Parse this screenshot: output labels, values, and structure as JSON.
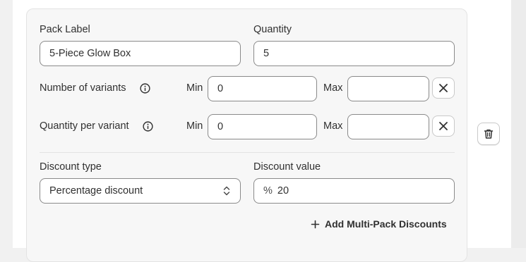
{
  "pack": {
    "pack_label": {
      "label": "Pack Label",
      "value": "5-Piece Glow Box"
    },
    "quantity": {
      "label": "Quantity",
      "value": "5"
    }
  },
  "variants_row": {
    "label": "Number of variants",
    "min_label": "Min",
    "min_value": "0",
    "max_label": "Max",
    "max_value": ""
  },
  "qty_variant_row": {
    "label": "Quantity per variant",
    "min_label": "Min",
    "min_value": "0",
    "max_label": "Max",
    "max_value": ""
  },
  "discount": {
    "type_label": "Discount type",
    "type_value": "Percentage discount",
    "value_label": "Discount value",
    "value_prefix": "%",
    "value": "20"
  },
  "add_link": {
    "icon": "plus-icon",
    "label": "Add Multi-Pack Discounts"
  },
  "icons": {
    "info": "info-icon",
    "clear": "close-icon",
    "delete": "trash-icon",
    "select": "chevron-updown-icon"
  },
  "colors": {
    "card_bg": "#f7f7f7",
    "border": "#8a8a8a",
    "text": "#303030",
    "page_bg": "#f1f1f1"
  }
}
